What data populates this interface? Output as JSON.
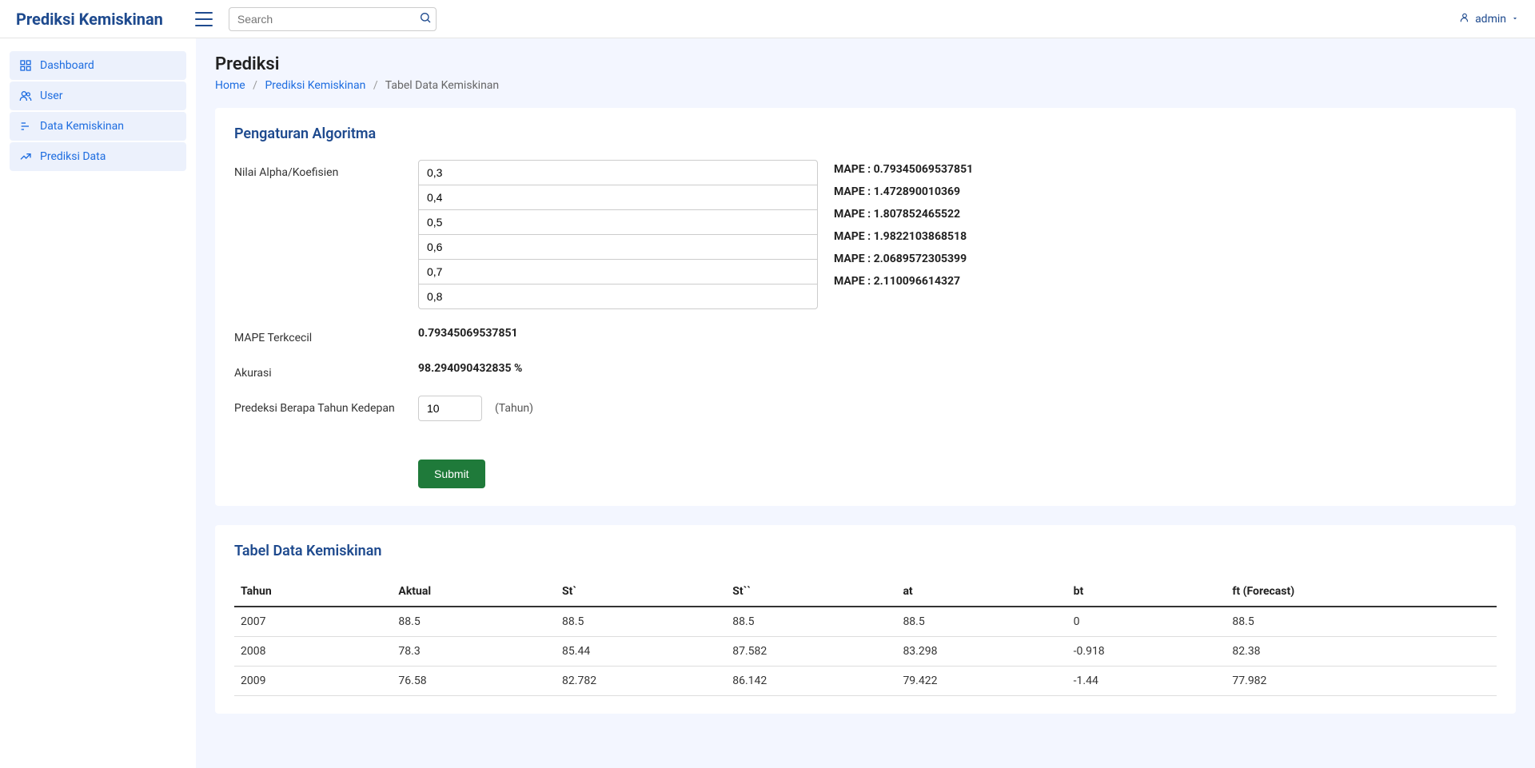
{
  "header": {
    "brand": "Prediksi Kemiskinan",
    "search_placeholder": "Search",
    "user_label": "admin"
  },
  "sidebar": {
    "items": [
      {
        "label": "Dashboard"
      },
      {
        "label": "User"
      },
      {
        "label": "Data Kemiskinan"
      },
      {
        "label": "Prediksi Data"
      }
    ]
  },
  "page": {
    "title": "Prediksi",
    "breadcrumb": {
      "home": "Home",
      "mid": "Prediksi Kemiskinan",
      "current": "Tabel Data Kemiskinan"
    }
  },
  "settings": {
    "card_title": "Pengaturan Algoritma",
    "alpha_label": "Nilai Alpha/Koefisien",
    "alpha_values": [
      "0,3",
      "0,4",
      "0,5",
      "0,6",
      "0,7",
      "0,8"
    ],
    "mape_values": [
      "MAPE : 0.79345069537851",
      "MAPE : 1.472890010369",
      "MAPE : 1.807852465522",
      "MAPE : 1.9822103868518",
      "MAPE : 2.0689572305399",
      "MAPE : 2.110096614327"
    ],
    "mape_min_label": "MAPE Terkcecil",
    "mape_min_value": "0.79345069537851",
    "accuracy_label": "Akurasi",
    "accuracy_value": "98.294090432835 %",
    "years_label": "Predeksi Berapa Tahun Kedepan",
    "years_value": "10",
    "years_unit": "(Tahun)",
    "submit_label": "Submit"
  },
  "table": {
    "card_title": "Tabel Data Kemiskinan",
    "headers": [
      "Tahun",
      "Aktual",
      "St`",
      "St``",
      "at",
      "bt",
      "ft (Forecast)"
    ],
    "rows": [
      [
        "2007",
        "88.5",
        "88.5",
        "88.5",
        "88.5",
        "0",
        "88.5"
      ],
      [
        "2008",
        "78.3",
        "85.44",
        "87.582",
        "83.298",
        "-0.918",
        "82.38"
      ],
      [
        "2009",
        "76.58",
        "82.782",
        "86.142",
        "79.422",
        "-1.44",
        "77.982"
      ]
    ]
  }
}
